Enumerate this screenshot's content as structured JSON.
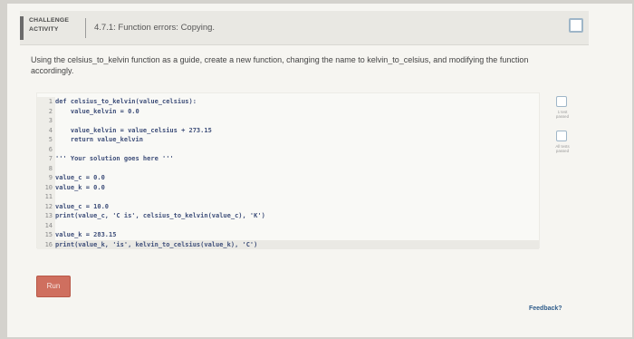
{
  "header": {
    "badge_line1": "CHALLENGE",
    "badge_line2": "ACTIVITY",
    "title": "4.7.1: Function errors: Copying."
  },
  "description": "Using the celsius_to_kelvin function as a guide, create a new function, changing the name to kelvin_to_celsius, and modifying the function accordingly.",
  "editor": {
    "lines": [
      {
        "n": "1",
        "text": "def celsius_to_kelvin(value_celsius):"
      },
      {
        "n": "2",
        "text": "    value_kelvin = 0.0"
      },
      {
        "n": "3",
        "text": ""
      },
      {
        "n": "4",
        "text": "    value_kelvin = value_celsius + 273.15"
      },
      {
        "n": "5",
        "text": "    return value_kelvin"
      },
      {
        "n": "6",
        "text": ""
      },
      {
        "n": "7",
        "text": "''' Your solution goes here '''"
      },
      {
        "n": "8",
        "text": ""
      },
      {
        "n": "9",
        "text": "value_c = 0.0"
      },
      {
        "n": "10",
        "text": "value_k = 0.0"
      },
      {
        "n": "11",
        "text": ""
      },
      {
        "n": "12",
        "text": "value_c = 10.0"
      },
      {
        "n": "13",
        "text": "print(value_c, 'C is', celsius_to_kelvin(value_c), 'K')"
      },
      {
        "n": "14",
        "text": ""
      },
      {
        "n": "15",
        "text": "value_k = 283.15"
      },
      {
        "n": "16",
        "text": "print(value_k, 'is', kelvin_to_celsius(value_k), 'C')"
      }
    ]
  },
  "tests": [
    {
      "label": "1 test passed"
    },
    {
      "label": "All tests passed"
    }
  ],
  "run_label": "Run",
  "feedback_label": "Feedback?"
}
